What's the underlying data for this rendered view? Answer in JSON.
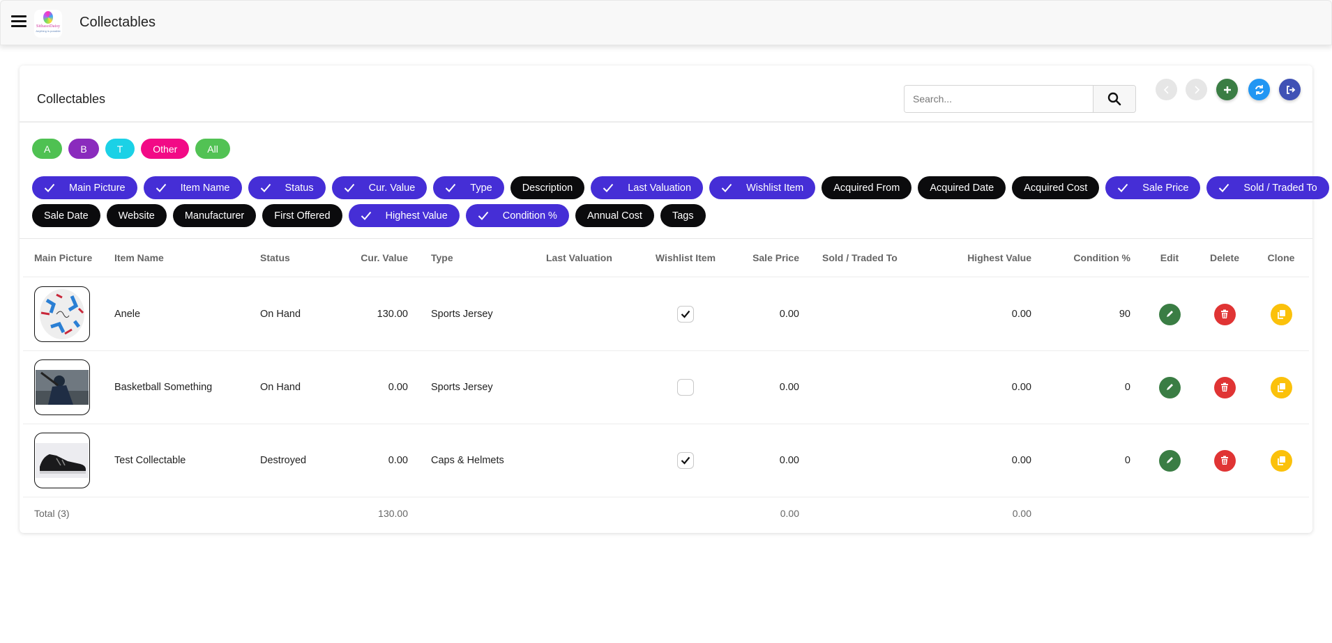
{
  "header": {
    "title": "Collectables",
    "logo_text": "SithasoDaisy",
    "logo_tagline": "Anything is possible"
  },
  "card": {
    "title": "Collectables",
    "search": {
      "placeholder": "Search...",
      "value": ""
    },
    "buttons": [
      {
        "name": "previous-button",
        "icon": "chevron-left-icon",
        "color": "#e6e6e6"
      },
      {
        "name": "next-button",
        "icon": "chevron-right-icon",
        "color": "#e6e6e6"
      },
      {
        "name": "add-button",
        "icon": "plus-icon",
        "color": "#3a7d44"
      },
      {
        "name": "refresh-button",
        "icon": "refresh-icon",
        "color": "#2196f3"
      },
      {
        "name": "logout-button",
        "icon": "sign-out-icon",
        "color": "#3f51b5"
      }
    ]
  },
  "letter_filters": [
    {
      "label": "A",
      "color": "#4fc152"
    },
    {
      "label": "B",
      "color": "#8a2bbd"
    },
    {
      "label": "T",
      "color": "#1bd1e6"
    },
    {
      "label": "Other",
      "color": "#f20a86"
    },
    {
      "label": "All",
      "color": "#52c254"
    }
  ],
  "column_chips_row1": [
    {
      "label": "Main Picture",
      "on": true
    },
    {
      "label": "Item Name",
      "on": true
    },
    {
      "label": "Status",
      "on": true
    },
    {
      "label": "Cur. Value",
      "on": true
    },
    {
      "label": "Type",
      "on": true
    },
    {
      "label": "Description",
      "on": false
    },
    {
      "label": "Last Valuation",
      "on": true
    },
    {
      "label": "Wishlist Item",
      "on": true
    },
    {
      "label": "Acquired From",
      "on": false
    },
    {
      "label": "Acquired Date",
      "on": false
    },
    {
      "label": "Acquired Cost",
      "on": false
    },
    {
      "label": "Sale Price",
      "on": true
    },
    {
      "label": "Sold / Traded To",
      "on": true
    }
  ],
  "column_chips_row2": [
    {
      "label": "Sale Date",
      "on": false
    },
    {
      "label": "Website",
      "on": false
    },
    {
      "label": "Manufacturer",
      "on": false
    },
    {
      "label": "First Offered",
      "on": false
    },
    {
      "label": "Highest Value",
      "on": true
    },
    {
      "label": "Condition %",
      "on": true
    },
    {
      "label": "Annual Cost",
      "on": false
    },
    {
      "label": "Tags",
      "on": false
    }
  ],
  "table": {
    "columns": {
      "pic": "Main Picture",
      "name": "Item Name",
      "status": "Status",
      "cur": "Cur. Value",
      "type": "Type",
      "lastval": "Last Valuation",
      "wish": "Wishlist Item",
      "sale": "Sale Price",
      "sold": "Sold / Traded To",
      "high": "Highest Value",
      "cond": "Condition %",
      "edit": "Edit",
      "del": "Delete",
      "clone": "Clone"
    },
    "rows": [
      {
        "picture": "soccer-ball",
        "name": "Anele",
        "status": "On Hand",
        "cur": "130.00",
        "type": "Sports Jersey",
        "lastval": "",
        "wish": true,
        "sale": "0.00",
        "sold": "",
        "high": "0.00",
        "cond": "90"
      },
      {
        "picture": "baseball-player",
        "name": "Basketball Something",
        "status": "On Hand",
        "cur": "0.00",
        "type": "Sports Jersey",
        "lastval": "",
        "wish": false,
        "sale": "0.00",
        "sold": "",
        "high": "0.00",
        "cond": "0"
      },
      {
        "picture": "sneaker",
        "name": "Test Collectable",
        "status": "Destroyed",
        "cur": "0.00",
        "type": "Caps & Helmets",
        "lastval": "",
        "wish": true,
        "sale": "0.00",
        "sold": "",
        "high": "0.00",
        "cond": "0"
      }
    ],
    "footer": {
      "label": "Total (3)",
      "cur": "130.00",
      "sale": "0.00",
      "high": "0.00"
    }
  },
  "colors": {
    "chip_on": "#452ed6",
    "chip_off": "#0b0b0d",
    "edit": "#3a7d44",
    "delete": "#e03434",
    "clone": "#fbc10b"
  }
}
